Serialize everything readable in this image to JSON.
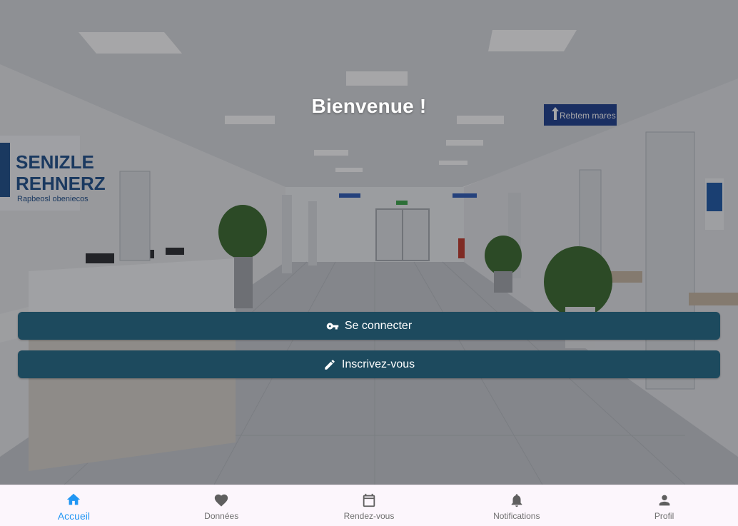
{
  "welcome": {
    "title": "Bienvenue !"
  },
  "actions": {
    "login_label": "Se connecter",
    "signup_label": "Inscrivez-vous"
  },
  "background": {
    "reception_sign_line1": "SENIZLE",
    "reception_sign_line2": "REHNERZ",
    "reception_sign_line3": "Rapbeosl obeniecos",
    "direction_sign": "Rebtem mares"
  },
  "bottom_nav": {
    "items": [
      {
        "label": "Accueil",
        "icon": "home-icon",
        "active": true
      },
      {
        "label": "Données",
        "icon": "heart-icon",
        "active": false
      },
      {
        "label": "Rendez-vous",
        "icon": "calendar-icon",
        "active": false
      },
      {
        "label": "Notifications",
        "icon": "bell-icon",
        "active": false
      },
      {
        "label": "Profil",
        "icon": "person-icon",
        "active": false
      }
    ]
  },
  "colors": {
    "button_bg": "#1d4a5e",
    "nav_active": "#2196f3",
    "nav_inactive": "#6f6f6f",
    "nav_bg": "#fcf6fc"
  }
}
